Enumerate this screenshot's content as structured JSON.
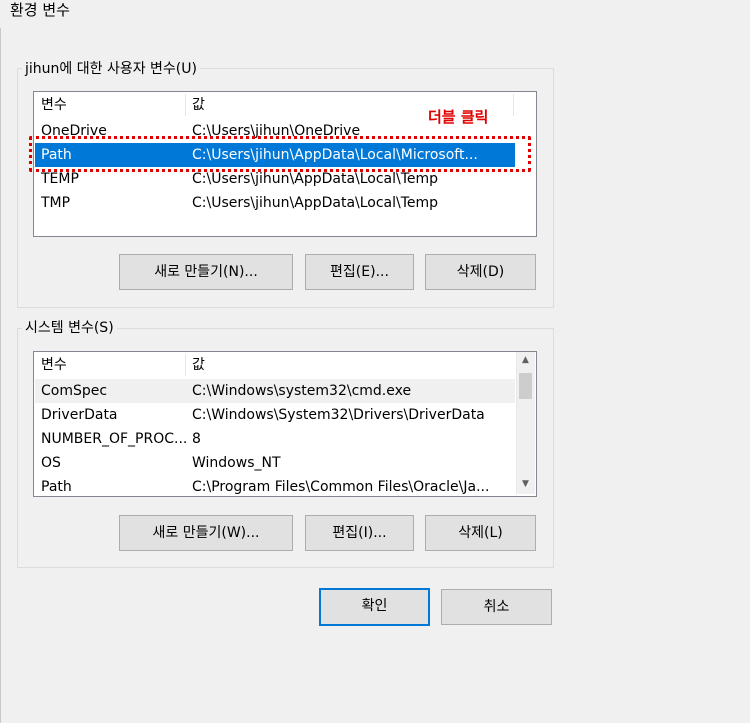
{
  "window": {
    "title": "환경 변수"
  },
  "user_vars": {
    "group_label": "jihun에 대한 사용자 변수(U)",
    "columns": [
      "변수",
      "값"
    ],
    "rows": [
      {
        "name": "OneDrive",
        "value": "C:\\Users\\jihun\\OneDrive"
      },
      {
        "name": "Path",
        "value": "C:\\Users\\jihun\\AppData\\Local\\Microsoft..."
      },
      {
        "name": "TEMP",
        "value": "C:\\Users\\jihun\\AppData\\Local\\Temp"
      },
      {
        "name": "TMP",
        "value": "C:\\Users\\jihun\\AppData\\Local\\Temp"
      }
    ],
    "selected_row": "Path",
    "buttons": {
      "new": "새로 만들기(N)...",
      "edit": "편집(E)...",
      "delete": "삭제(D)"
    }
  },
  "annotation": {
    "text": "더블 클릭",
    "color": "#e00000"
  },
  "system_vars": {
    "group_label": "시스템 변수(S)",
    "columns": [
      "변수",
      "값"
    ],
    "rows": [
      {
        "name": "ComSpec",
        "value": "C:\\Windows\\system32\\cmd.exe"
      },
      {
        "name": "DriverData",
        "value": "C:\\Windows\\System32\\Drivers\\DriverData"
      },
      {
        "name": "NUMBER_OF_PROC...",
        "value": "8"
      },
      {
        "name": "OS",
        "value": "Windows_NT"
      },
      {
        "name": "Path",
        "value": "C:\\Program Files\\Common Files\\Oracle\\Ja..."
      }
    ],
    "buttons": {
      "new": "새로 만들기(W)...",
      "edit": "편집(I)...",
      "delete": "삭제(L)"
    }
  },
  "footer": {
    "ok": "확인",
    "cancel": "취소"
  },
  "colors": {
    "selection": "#0078d7",
    "window_bg": "#f0f0f0"
  }
}
